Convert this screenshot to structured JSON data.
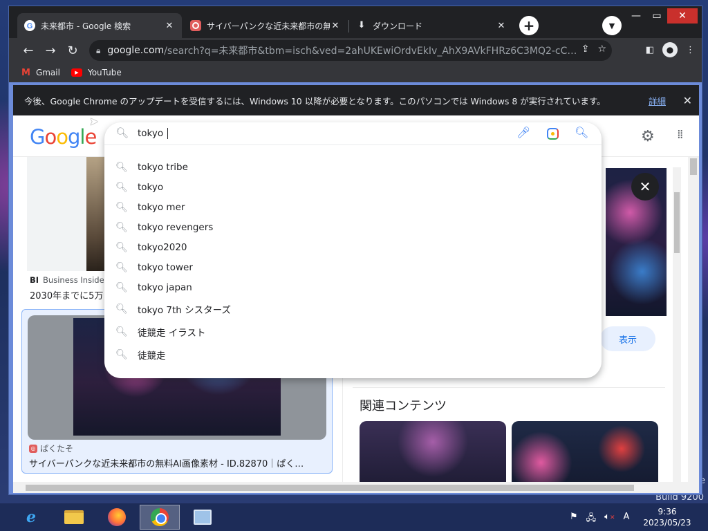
{
  "browser": {
    "tabs": [
      {
        "title": "未来都市 - Google 検索",
        "favicon": "google-g-icon",
        "active": true
      },
      {
        "title": "サイバーパンクな近未来都市の無料AI",
        "favicon": "pakutaso-icon",
        "active": false
      },
      {
        "title": "ダウンロード",
        "favicon": "download-icon",
        "active": false
      }
    ],
    "url_host": "google.com",
    "url_rest": "/search?q=未来都市&tbm=isch&ved=2ahUKEwiOrdvEkIv_AhX9AVkFHRz6C3MQ2-cC…",
    "bookmarks": [
      {
        "label": "Gmail",
        "icon": "gmail-icon"
      },
      {
        "label": "YouTube",
        "icon": "youtube-icon"
      }
    ],
    "infobar_text": "今後、Google Chrome のアップデートを受信するには、Windows 10 以降が必要となります。このパソコンでは Windows 8 が実行されています。",
    "infobar_link": "詳細"
  },
  "google": {
    "logo_letters": [
      "G",
      "o",
      "o",
      "g",
      "l",
      "e"
    ],
    "query": "tokyo ",
    "suggestions": [
      "tokyo tribe",
      "tokyo",
      "tokyo mer",
      "tokyo revengers",
      "tokyo2020",
      "tokyo tower",
      "tokyo japan",
      "tokyo 7th シスターズ",
      "徒競走 イラスト",
      "徒競走"
    ]
  },
  "results": {
    "first_source_badge": "BI",
    "first_source": "Business Insider",
    "first_title": "2030年までに5万",
    "second_source": "ぱくたそ",
    "second_title": "サイバーパンクな近未来都市の無料AI画像素材 - ID.82870｜ぱく…"
  },
  "preview": {
    "view_label": "表示",
    "related_title": "関連コンテンツ"
  },
  "desktop": {
    "edge_text": "e",
    "build_text": "Build 9200"
  },
  "taskbar": {
    "apps": [
      "internet-explorer-icon",
      "file-explorer-icon",
      "firefox-icon",
      "chrome-icon",
      "control-panel-icon"
    ],
    "ime": "A",
    "time": "9:36",
    "date": "2023/05/23"
  },
  "colors": {
    "chrome_dark": "#202124",
    "google_blue": "#4285f4",
    "google_red": "#ea4335",
    "google_yellow": "#fbbc05",
    "google_green": "#34a853",
    "link_blue": "#1a73e8"
  }
}
